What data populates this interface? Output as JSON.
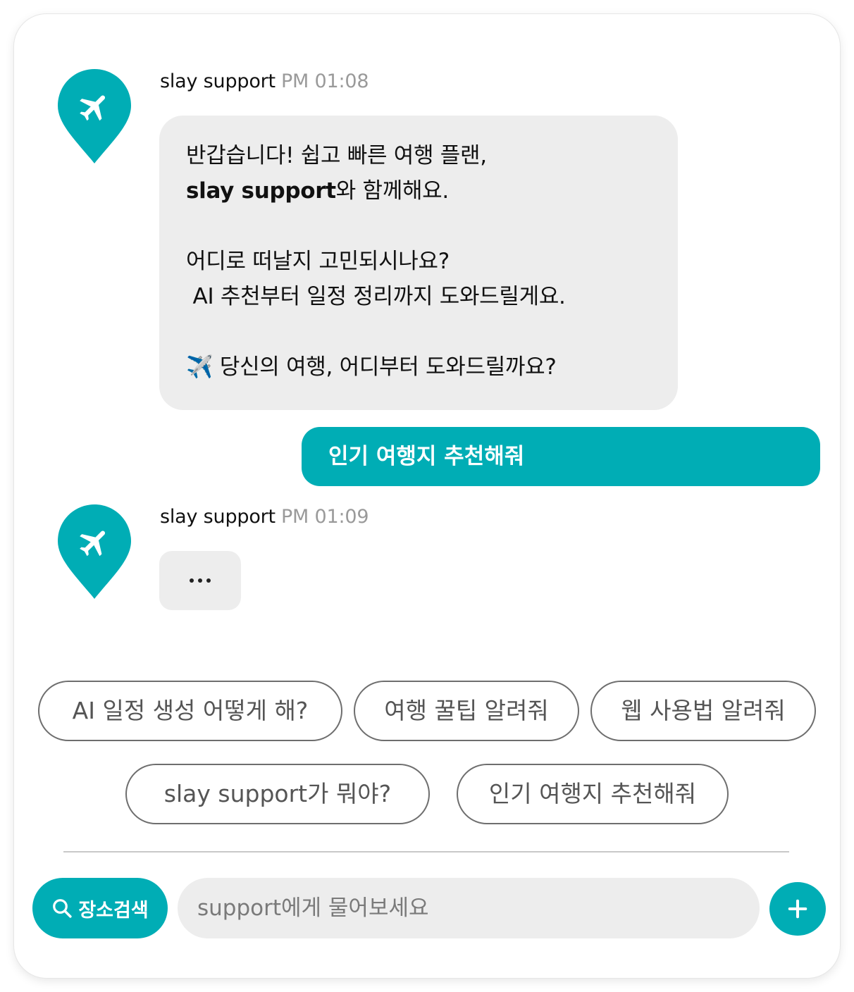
{
  "colors": {
    "accent": "#00adb5",
    "bubble_bg": "#ededed",
    "muted_text": "#9a9a9a"
  },
  "messages": [
    {
      "sender": "slay support",
      "time": "PM 01:08",
      "avatar_icon": "airplane-pin-icon",
      "lines": [
        {
          "text": "반갑습니다! 쉽고 빠른 여행 플랜,"
        },
        {
          "bold": "slay support",
          "text": "와 함께해요."
        },
        {
          "text": ""
        },
        {
          "text": "어디로 떠날지 고민되시나요?"
        },
        {
          "text": " AI 추천부터 일정 정리까지 도와드릴게요."
        },
        {
          "text": ""
        },
        {
          "text": "✈️ 당신의 여행, 어디부터 도와드릴까요?"
        }
      ]
    },
    {
      "sender": "slay support",
      "time": "PM 01:09",
      "avatar_icon": "airplane-pin-icon",
      "typing": "..."
    }
  ],
  "user_message": "인기 여행지 추천해줘",
  "suggestions": [
    "AI 일정 생성 어떻게 해?",
    "여행 꿀팁 알려줘",
    "웹 사용법 알려줘",
    "slay support가 뭐야?",
    "인기 여행지 추천해줘"
  ],
  "footer": {
    "search_button_label": "장소검색",
    "search_icon": "search-icon",
    "input_placeholder": "support에게 물어보세요",
    "input_value": "",
    "add_icon": "plus-icon"
  }
}
